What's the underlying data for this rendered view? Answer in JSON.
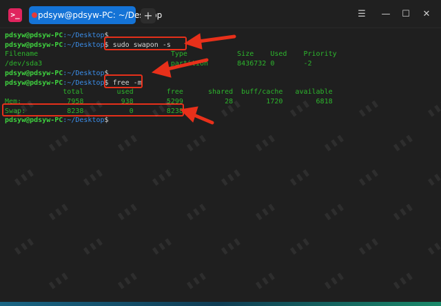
{
  "window": {
    "tab_title": "pdsyw@pdsyw-PC: ~/Desktop",
    "new_tab_symbol": "+",
    "menu_symbol": "☰",
    "minimize_symbol": "—",
    "maximize_symbol": "☐",
    "close_symbol": "✕"
  },
  "terminal": {
    "prompt_user": "pdsyw@pdsyw-PC",
    "prompt_path": ":~/Desktop",
    "prompt_sign": "$",
    "lines": [
      {
        "kind": "prompt",
        "cmd": ""
      },
      {
        "kind": "prompt",
        "cmd": " sudo swapon -s"
      },
      {
        "kind": "output",
        "text": "Filename                                Type            Size    Used    Priority"
      },
      {
        "kind": "output",
        "text": "/dev/sda3                               partition       8436732 0       -2"
      },
      {
        "kind": "prompt",
        "cmd": ""
      },
      {
        "kind": "prompt",
        "cmd": " free -m"
      },
      {
        "kind": "output",
        "text": "              total        used        free      shared  buff/cache   available"
      },
      {
        "kind": "output",
        "text": "Mem:           7958         938        5299          28        1720        6818"
      },
      {
        "kind": "output",
        "text": "Swap:          8238           0        8238"
      },
      {
        "kind": "prompt",
        "cmd": ""
      }
    ]
  },
  "colors": {
    "prompt_user": "#3fd23f",
    "prompt_path": "#3b8eea",
    "output": "#2db72d",
    "highlight": "#e8301a",
    "tab": "#1473d6"
  },
  "icons": {
    "app": "terminal-icon",
    "annotations": "red-arrow-icon"
  }
}
